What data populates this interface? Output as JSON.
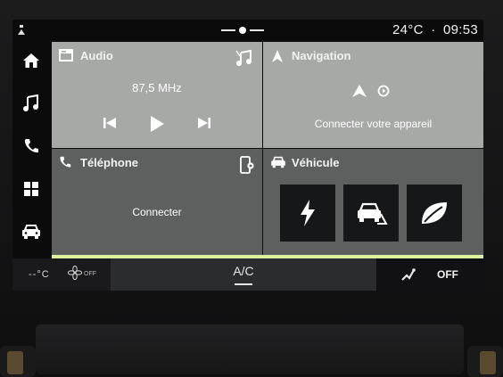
{
  "status": {
    "temperature": "24°C",
    "separator": "·",
    "time": "09:53"
  },
  "sidebar": {
    "items": [
      {
        "icon": "home-icon"
      },
      {
        "icon": "music-note-icon"
      },
      {
        "icon": "phone-icon"
      },
      {
        "icon": "apps-grid-icon"
      },
      {
        "icon": "car-icon"
      }
    ]
  },
  "audio": {
    "title": "Audio",
    "frequency": "87,5 MHz",
    "icons": [
      "radio-icon",
      "music-source-icon",
      "previous-track-icon",
      "play-icon",
      "next-track-icon"
    ]
  },
  "navigation": {
    "title": "Navigation",
    "message": "Connecter votre appareil",
    "icons": [
      "navigation-arrow-icon",
      "android-auto-icon",
      "carplay-icon"
    ]
  },
  "telephone": {
    "title": "Téléphone",
    "message": "Connecter",
    "icons": [
      "phone-icon",
      "phone-settings-icon"
    ]
  },
  "vehicle": {
    "title": "Véhicule",
    "buttons": [
      {
        "icon": "lightning-icon"
      },
      {
        "icon": "driving-mode-icon"
      },
      {
        "icon": "eco-leaf-icon"
      }
    ]
  },
  "climate": {
    "temperature_display": "--°C",
    "fan_status": "OFF",
    "ac_label": "A/C",
    "seat_status": "OFF"
  },
  "colors": {
    "accent": "#ddf19a",
    "tile_light": "#a7a9a7",
    "tile_dark": "#5e605f",
    "screen_bg": "#0b0b0c"
  }
}
